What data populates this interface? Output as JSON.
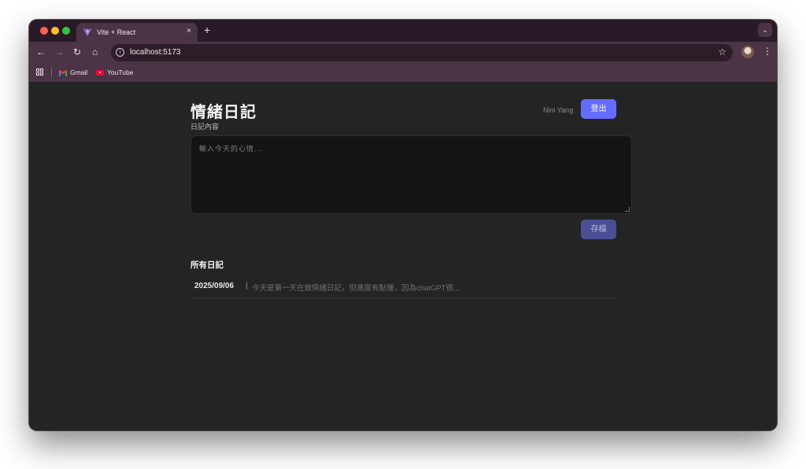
{
  "browser": {
    "tab_title": "Vite + React",
    "tab_close": "×",
    "new_tab": "+",
    "url": "localhost:5173",
    "bookmarks": [
      {
        "label": "Gmail"
      },
      {
        "label": "YouTube"
      }
    ]
  },
  "app": {
    "title": "情緒日記",
    "username": "Nini Yang",
    "logout_label": "登出",
    "editor_label": "日記內容",
    "editor_placeholder": "輸入今天的心情...",
    "save_label": "存檔",
    "list_title": "所有日記",
    "entries": [
      {
        "date": "2025/09/06",
        "separator": "|",
        "preview": "今天是第一天在做情緒日記，但進度有點慢，因為chatGPT很..."
      }
    ]
  },
  "colors": {
    "accent": "#646cff",
    "accent_disabled": "#4b4f95",
    "page_bg": "#242424",
    "browser_chrome": "#4a3445"
  },
  "icons": [
    "vite-icon",
    "close-icon",
    "plus-icon",
    "chevron-down-icon",
    "back-icon",
    "forward-icon",
    "reload-icon",
    "home-icon",
    "info-icon",
    "star-icon",
    "avatar",
    "kebab-menu-icon",
    "apps-icon",
    "gmail-icon",
    "youtube-icon"
  ]
}
